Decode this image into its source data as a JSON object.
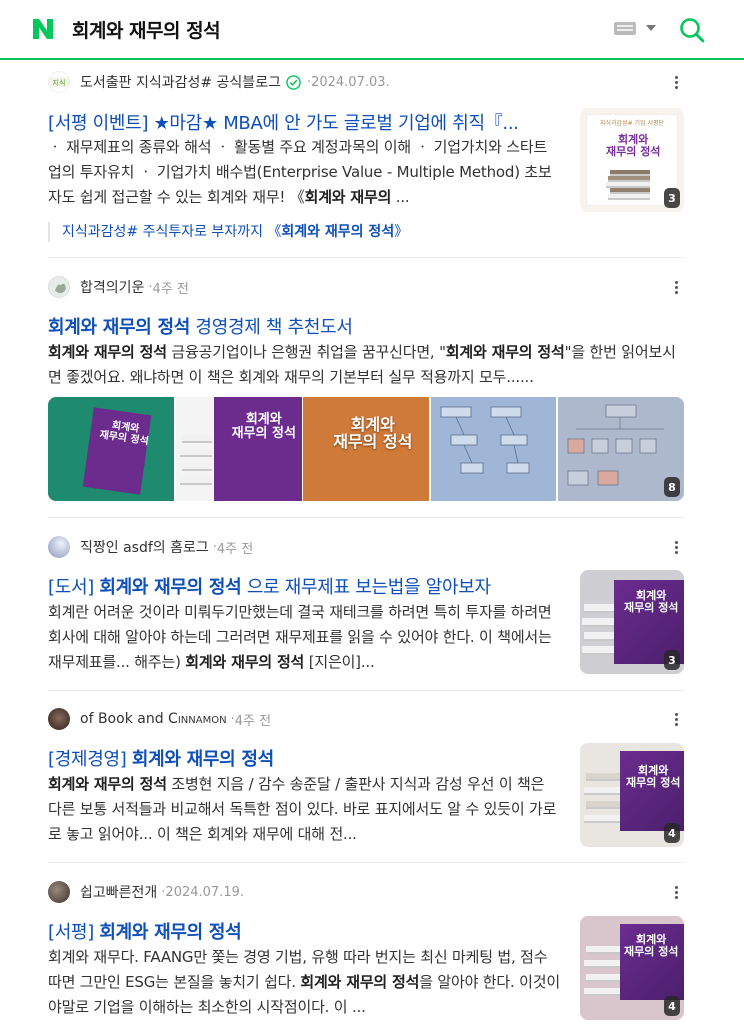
{
  "search": {
    "query": "회계와 재무의 정석"
  },
  "results": [
    {
      "source": "도서출판 지식과감성# 공식블로그",
      "time": "2024.07.03.",
      "title": "[서평 이벤트] ★마감★ MBA에 안 가도 글로벌 기업에 취직『...",
      "desc": [
        "ㆍ 재무제표의 종류와 해석 ㆍ 활동별 주요 계정과목의 이해 ㆍ 기업가치와 스타트업의 투자유치 ㆍ 기업가치 배수법(Enterprise Value - Multiple Method) 초보자도 쉽게 접근할 수 있는 회계와 재무! 《",
        "회계와 재무의",
        " ..."
      ],
      "sub_prefix": "지식과감성# 주식투자로 부자까지 《",
      "sub_bold": "회계와 재무의 정석",
      "sub_suffix": "》",
      "thumb_count": "3",
      "thumb_title": "회계와\n재무의 정석",
      "thumb_caption": "지식과감성# 기업 서평단"
    },
    {
      "source": "합격의기운",
      "time": "4주 전",
      "title_bold": "회계와 재무의 정석",
      "title_rest": " 경영경제 책 추천도서",
      "desc_b1": "회계와 재무의 정석",
      "desc_t1": " 금융공기업이나 은행권 취업을 꿈꾸신다면, \"",
      "desc_b2": "회계와 재무의 정석",
      "desc_t2": "\"을 한번 읽어보시면 좋겠어요. 왜냐하면 이 책은 회계와 재무의 기본부터 실무 적용까지 모두......",
      "img_count": "8"
    },
    {
      "source": "직짱인 asdf의 홈로그",
      "time": "4주 전",
      "title_pre": "[도서] ",
      "title_bold": "회계와 재무의 정석",
      "title_rest": " 으로 재무제표 보는법을 알아보자",
      "desc_t1": "회계란 어려운 것이라 미뤄두기만했는데 결국 재테크를 하려면 특히 투자를 하려면 회사에 대해 알아야 하는데 그러려면 재무제표를 읽을 수 있어야 한다. 이 책에서는 재무제표를... 해주는) ",
      "desc_b1": "회계와 재무의 정석",
      "desc_t2": " [지은이]...",
      "thumb_count": "3"
    },
    {
      "source_pre": "of ",
      "source_a": "Book",
      "source_mid": " and ",
      "source_b": "Cinnamon",
      "time": "4주 전",
      "title_pre": "[경제경영] ",
      "title_bold": "회계와 재무의 정석",
      "desc_b1": "회계와 재무의 정석",
      "desc_t1": " 조병현 지음 / 감수 송준달 / 출판사 지식과 감성 우선 이 책은 다른 보통 서적들과 비교해서 독특한 점이 있다. 바로 표지에서도 알 수 있듯이 가로로 놓고 읽어야... 이 책은 회계와 재무에 대해 전...",
      "thumb_count": "4"
    },
    {
      "source": "쉽고빠른전개",
      "time": "2024.07.19.",
      "title_pre": "[서평] ",
      "title_bold": "회계와 재무의 정석",
      "desc_t1": "회계와 재무다. FAANG만 쫓는 경영 기법, 유행 따라 번지는 최신 마케팅 법, 점수 따면 그만인 ESG는 본질을 놓치기 쉽다. ",
      "desc_b1": "회계와 재무의 정석",
      "desc_t2": "을 알아야 한다. 이것이야말로 기업을 이해하는 최소한의 시작점이다. 이 ...",
      "thumb_count": "4"
    }
  ],
  "cover_text": "회계와\n재무의 정석",
  "colors": {
    "accent": "#03c75a",
    "link": "#0e4fb9"
  }
}
